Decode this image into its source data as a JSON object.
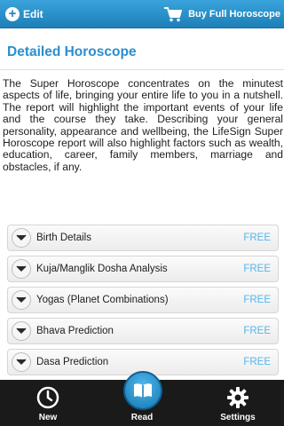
{
  "topbar": {
    "edit_label": "Edit",
    "buy_label": "Buy Full Horoscope"
  },
  "main": {
    "title": "Detailed Horoscope",
    "description": "The Super Horoscope concentrates on the minutest aspects of life, bringing your entire life to you in a nutshell. The report will highlight the important events of your life and the course they take. Describing your general personality, appearance and wellbeing, the LifeSign Super Horoscope report will also highlight factors such as wealth, education, career, family members, marriage and obstacles, if any.",
    "items": [
      {
        "label": "Birth Details",
        "status": "FREE"
      },
      {
        "label": "Kuja/Manglik Dosha Analysis",
        "status": "FREE"
      },
      {
        "label": "Yogas (Planet Combinations)",
        "status": "FREE"
      },
      {
        "label": "Bhava Prediction",
        "status": "FREE"
      },
      {
        "label": "Dasa Prediction",
        "status": "FREE"
      }
    ]
  },
  "bottom_nav": {
    "new_label": "New",
    "read_label": "Read",
    "settings_label": "Settings"
  },
  "colors": {
    "accent": "#2a8ed0",
    "free_text": "#55b5e8",
    "topbar": "#1d7fb8",
    "bottombar": "#1a1a1a"
  },
  "icons": {
    "edit": "plus-circle-icon",
    "buy": "cart-icon",
    "expand": "chevron-down-icon",
    "new": "clock-icon",
    "read": "book-icon",
    "settings": "gear-icon"
  }
}
